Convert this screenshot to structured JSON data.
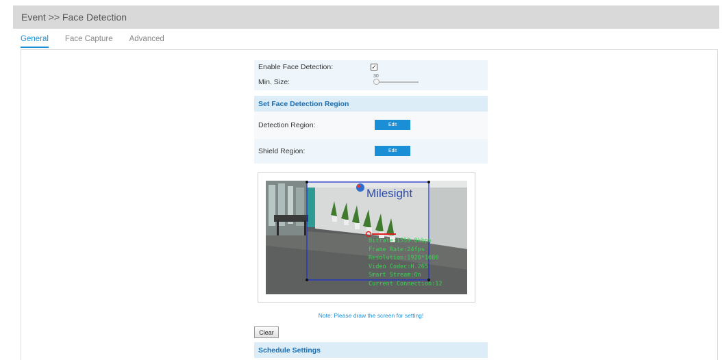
{
  "header": {
    "breadcrumb": "Event >> Face Detection"
  },
  "tabs": [
    {
      "label": "General",
      "active": true
    },
    {
      "label": "Face Capture",
      "active": false
    },
    {
      "label": "Advanced",
      "active": false
    }
  ],
  "form": {
    "enable_label": "Enable Face Detection:",
    "enable_checked": true,
    "min_size_label": "Min. Size:",
    "min_size_value": "30",
    "region_section_title": "Set Face Detection Region",
    "detection_region_label": "Detection Region:",
    "shield_region_label": "Shield Region:",
    "edit_label": "Edit"
  },
  "video": {
    "logo_text": "Milesight",
    "overlay_lines": [
      "Bitrate:1559.8kbps",
      "Frame Rate:24fps",
      "Resolution:1920*1080",
      "Video Codec:H.265",
      "Smart Stream:On",
      "Current Connection:12"
    ]
  },
  "note": "Note: Please draw the screen for setting!",
  "clear_label": "Clear",
  "schedule_section_title": "Schedule Settings",
  "colors": {
    "accent": "#1a8fd6",
    "section_bg": "#dcedf8",
    "row_bg": "#eef6fb",
    "region_box": "#1a2fd6",
    "overlay_text": "#39d353"
  }
}
